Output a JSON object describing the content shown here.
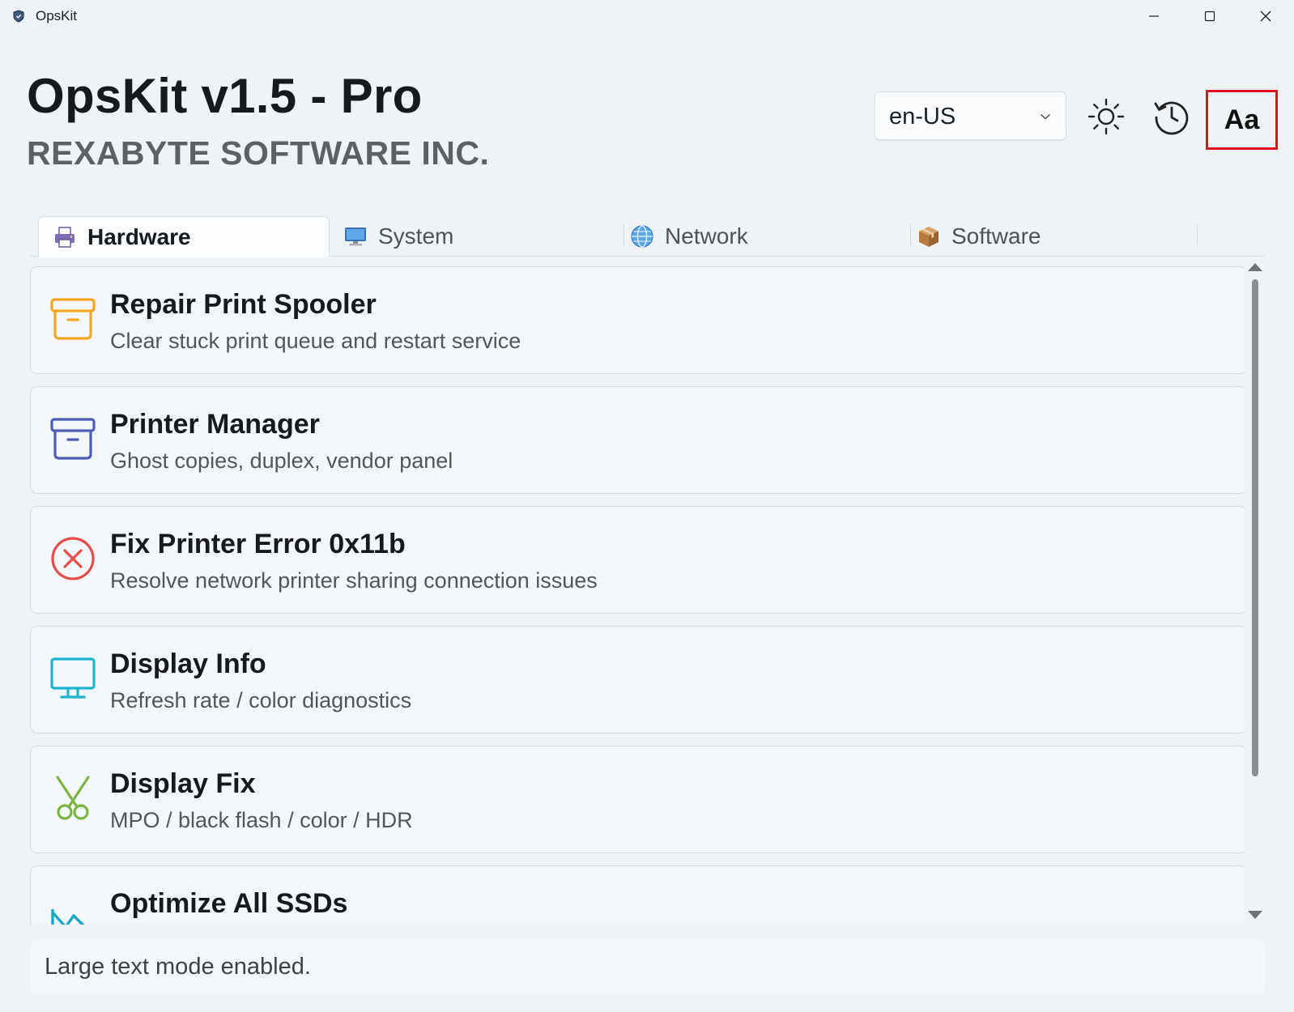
{
  "window": {
    "title": "OpsKit"
  },
  "header": {
    "app_name": "OpsKit v1.5 - Pro",
    "company": "REXABYTE SOFTWARE INC.",
    "language": {
      "selected": "en-US"
    },
    "font_button_label": "Aa"
  },
  "tabs": [
    {
      "label": "Hardware",
      "icon": "printer-icon",
      "active": true
    },
    {
      "label": "System",
      "icon": "monitor-icon",
      "active": false
    },
    {
      "label": "Network",
      "icon": "globe-icon",
      "active": false
    },
    {
      "label": "Software",
      "icon": "package-icon",
      "active": false
    }
  ],
  "tools": [
    {
      "title": "Repair Print Spooler",
      "description": "Clear stuck print queue and restart service",
      "icon": "archive-box-icon",
      "color": "#f4a623"
    },
    {
      "title": "Printer Manager",
      "description": "Ghost copies, duplex, vendor panel",
      "icon": "archive-box-icon",
      "color": "#4e5cb8"
    },
    {
      "title": "Fix Printer Error 0x11b",
      "description": "Resolve network printer sharing connection issues",
      "icon": "error-circle-icon",
      "color": "#e84b4b"
    },
    {
      "title": "Display Info",
      "description": "Refresh rate / color diagnostics",
      "icon": "monitor-icon",
      "color": "#1fb3cc"
    },
    {
      "title": "Display Fix",
      "description": "MPO / black flash / color / HDR",
      "icon": "scissors-icon",
      "color": "#7cb342"
    },
    {
      "title": "Optimize All SSDs",
      "description": "",
      "icon": "chart-icon",
      "color": "#1aa8c4"
    }
  ],
  "status": {
    "message": "Large text mode enabled."
  }
}
